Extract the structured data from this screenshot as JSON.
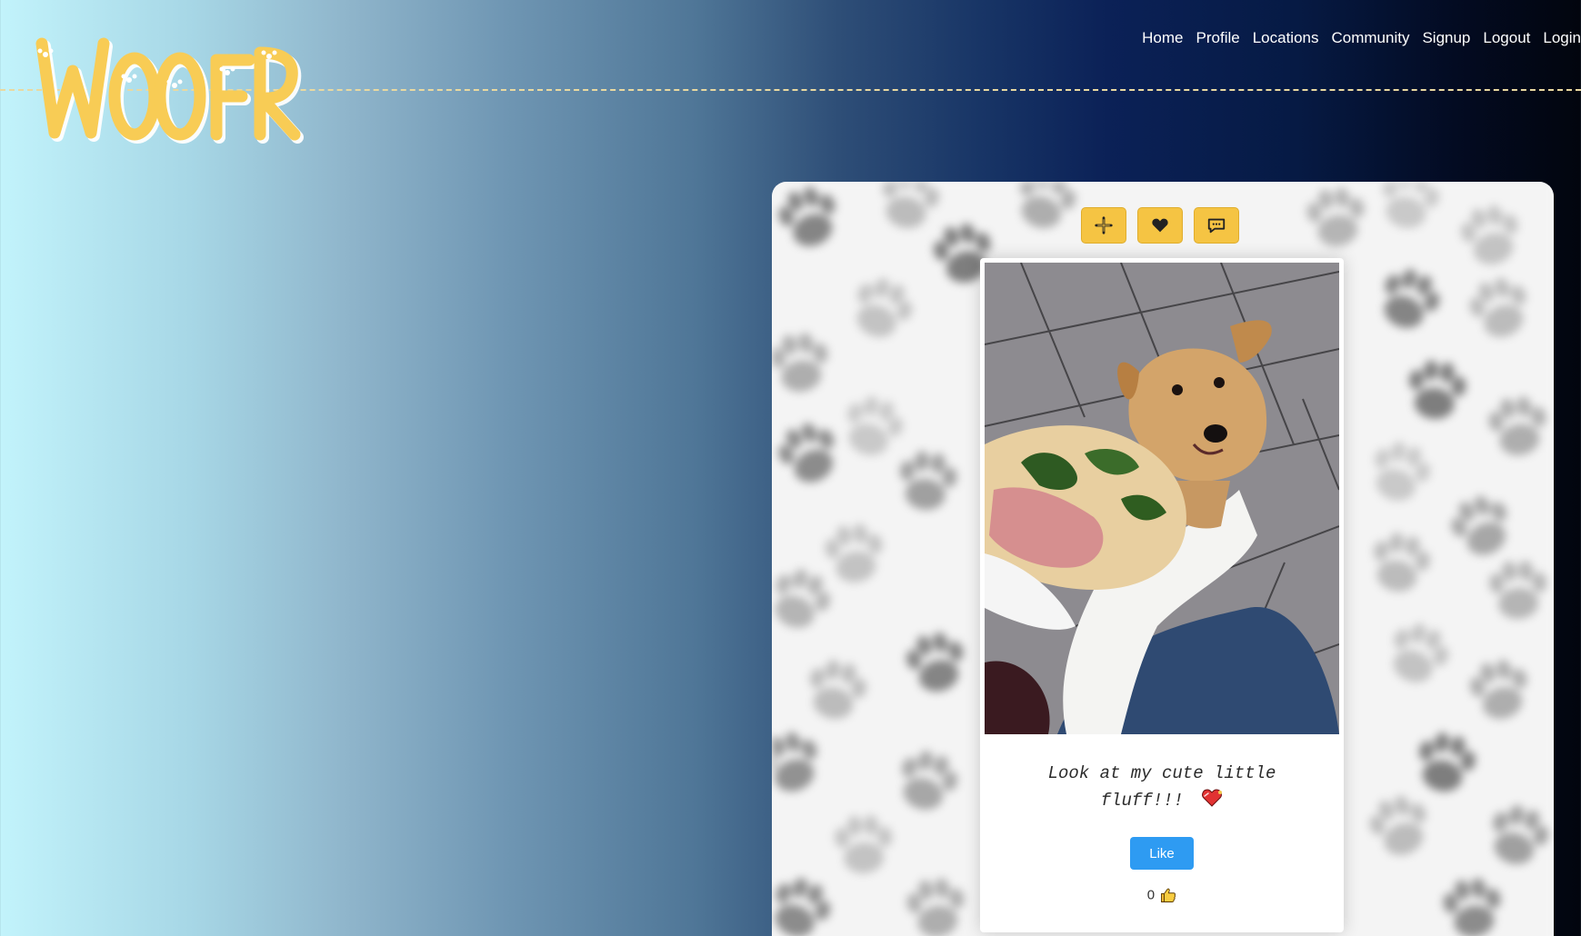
{
  "brand": {
    "logo_text": "WOOFR",
    "logo_color": "#f8cc55"
  },
  "nav": {
    "items": [
      "Home",
      "Profile",
      "Locations",
      "Community",
      "Signup",
      "Logout",
      "Login"
    ]
  },
  "toolbar": {
    "buttons": [
      {
        "icon": "plus-icon"
      },
      {
        "icon": "heart-icon"
      },
      {
        "icon": "comment-icon"
      }
    ],
    "button_color": "#f5c443"
  },
  "post": {
    "caption_line1": "Look at my cute little",
    "caption_line2": "fluff!!!",
    "caption_emoji": "heart-emoji",
    "like_label": "Like",
    "like_count": "0",
    "like_icon": "thumbs-up-icon",
    "like_button_color": "#2e9bf2",
    "photo_subject": "dog-photo"
  }
}
